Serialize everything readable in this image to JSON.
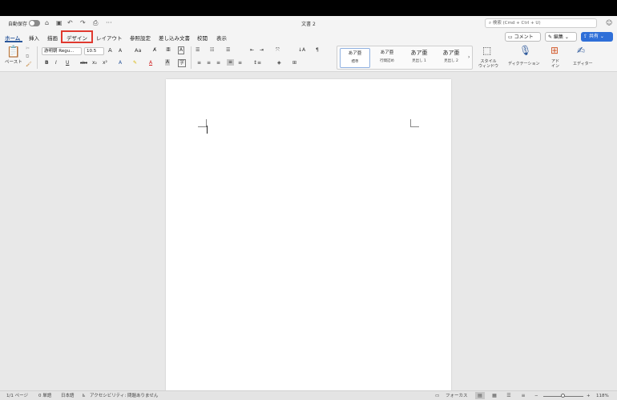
{
  "titlebar": {
    "autosave_label": "自動保存",
    "doc_title": "文書 2",
    "search_placeholder": "検索 (Cmd + Ctrl + U)",
    "icons": [
      "home-icon",
      "save-icon",
      "undo-icon",
      "redo-icon",
      "print-icon",
      "more-icon",
      "help-icon"
    ],
    "more_label": "···"
  },
  "tabs": [
    {
      "label": "ホーム",
      "active": true
    },
    {
      "label": "挿入"
    },
    {
      "label": "描画"
    },
    {
      "label": "デザイン",
      "highlighted": true
    },
    {
      "label": "レイアウト"
    },
    {
      "label": "参照設定"
    },
    {
      "label": "差し込み文書"
    },
    {
      "label": "校閲"
    },
    {
      "label": "表示"
    }
  ],
  "header_actions": {
    "comment_label": "コメント",
    "edit_label": "編集",
    "share_label": "共有"
  },
  "ribbon": {
    "paste_label": "ペースト",
    "font_name": "游明朝 Regu...",
    "font_size": "10.5",
    "grow_font": "A",
    "shrink_font": "A",
    "change_case": "Aa",
    "bold": "B",
    "italic": "I",
    "underline": "U",
    "strike": "abc",
    "subscript": "x₂",
    "superscript": "x²",
    "styles": [
      {
        "name": "あア亜",
        "label": "標準"
      },
      {
        "name": "あア亜",
        "label": "行間詰め"
      },
      {
        "name": "あア亜",
        "label": "見出し 1"
      },
      {
        "name": "あア亜",
        "label": "見出し 2"
      }
    ],
    "styles_pane_label": "スタイル\nウィンドウ",
    "dictation_label": "ディクテーション",
    "addins_label": "アド\nイン",
    "editor_label": "エディター"
  },
  "statusbar": {
    "page": "1/1 ページ",
    "words": "0 単語",
    "language": "日本語",
    "accessibility": "アクセシビリティ: 問題ありません",
    "focus": "フォーカス",
    "zoom": "118%",
    "zoom_minus": "−",
    "zoom_plus": "+"
  }
}
